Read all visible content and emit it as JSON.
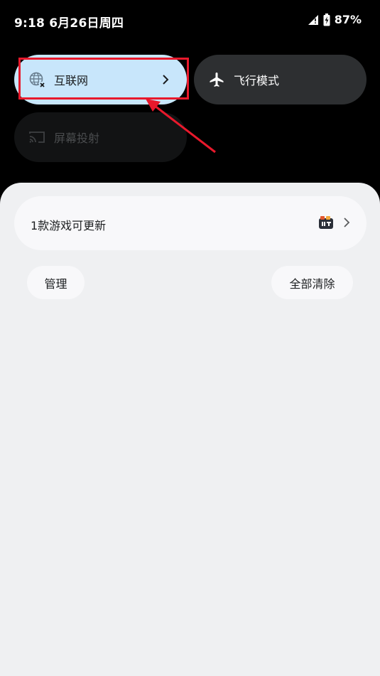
{
  "status_bar": {
    "time_date": "9:18 6月26日周四",
    "battery_percent": "87%"
  },
  "quick_settings": {
    "internet_label": "互联网",
    "airplane_label": "飞行模式",
    "cast_label": "屏幕投射"
  },
  "notification": {
    "text": "1款游戏可更新"
  },
  "actions": {
    "manage_label": "管理",
    "clear_all_label": "全部清除"
  },
  "colors": {
    "internet_tile": "#c8e6fb",
    "airplane_tile": "#2d2f31",
    "cast_tile": "#121314",
    "shade_bg": "#eff0f2",
    "highlight": "#e8192c"
  },
  "icons": {
    "internet": "globe-x-icon",
    "airplane": "airplane-icon",
    "cast": "cast-icon",
    "chevron": "chevron-right-icon",
    "app": "game-center-app-icon"
  }
}
